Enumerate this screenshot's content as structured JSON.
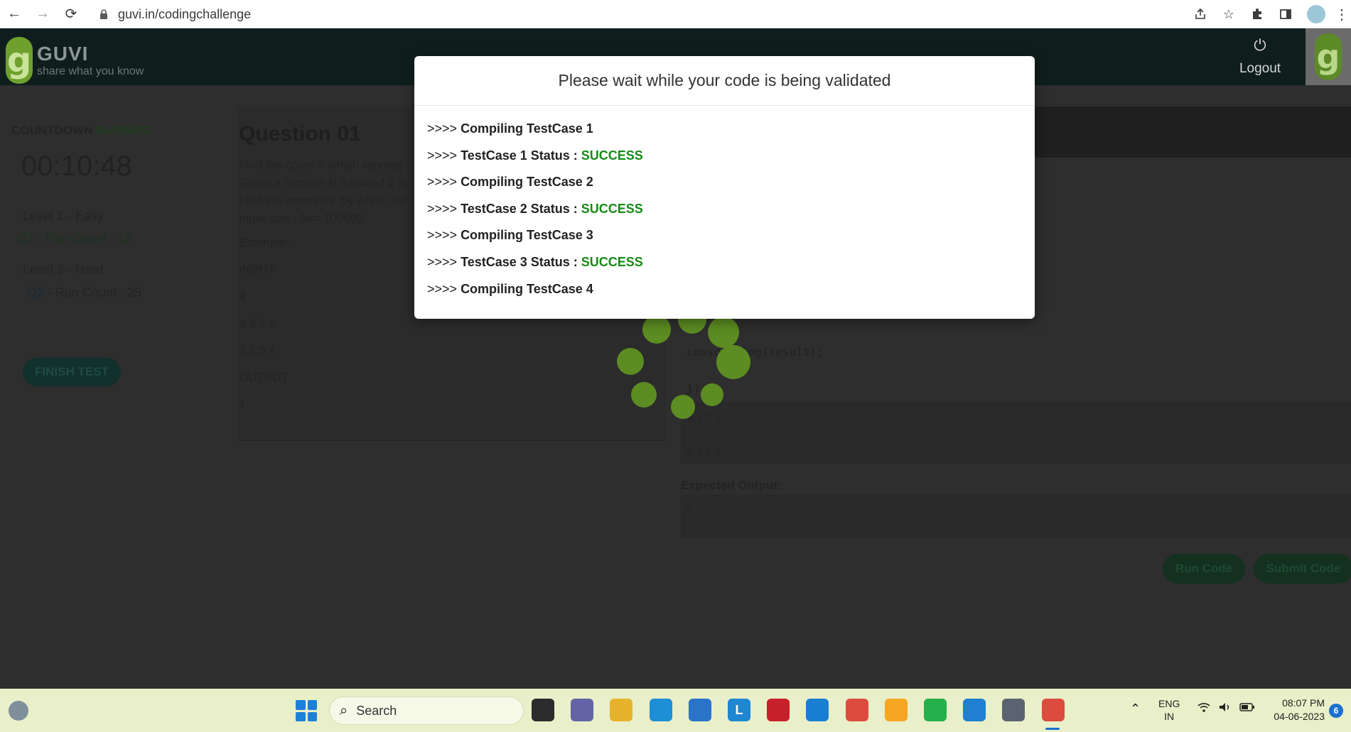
{
  "browser": {
    "url": "guvi.in/codingchallenge",
    "nav": {
      "back": "←",
      "forward": "→",
      "reload": "⟳"
    }
  },
  "header": {
    "logo_title": "GUVI",
    "logo_subtitle": "share what you know",
    "logo_mark": "g",
    "logout_icon": "⏻",
    "logout_label": "Logout"
  },
  "sidebar": {
    "countdown_label": "COUNTDOWN",
    "countdown_state": "RUNNING",
    "timer": "00:10:48",
    "level1": "Level 1 - Easy",
    "q1": "Q1 - Run Count : 12",
    "level3": "Level 3 - Hard",
    "q2_num": "Q2",
    "q2_rest": " - Run Count : 25",
    "finish_button": "FINISH TEST"
  },
  "question": {
    "title": "Question 01",
    "lines": [
      "Find the count k which represe",
      "Given a number N followed 2 ar",
      "Find the amount K by which the",
      "Input size : N<=100000"
    ],
    "example_label": "Example :",
    "input_label": "INPUT",
    "input_lines": [
      "4",
      "4 3 2 5",
      "3 2 5 4"
    ],
    "output_label": "OUTPUT",
    "output_value": "1"
  },
  "editor": {
    "code_line": "console.log(result);",
    "code_line2": "});",
    "sample_input_lines": [
      "4 3 2 5",
      "3 2 5 4"
    ],
    "expected_label": "Expected Output:",
    "expected_value": "1",
    "run_button": "Run Code",
    "submit_button": "Submit Code"
  },
  "modal": {
    "title": "Please wait while your code is being validated",
    "log": [
      {
        "prefix": ">>>> ",
        "msg": "Compiling TestCase 1",
        "status": ""
      },
      {
        "prefix": ">>>> ",
        "msg": "TestCase 1 Status : ",
        "status": "SUCCESS"
      },
      {
        "prefix": ">>>> ",
        "msg": "Compiling TestCase 2",
        "status": ""
      },
      {
        "prefix": ">>>> ",
        "msg": "TestCase 2 Status : ",
        "status": "SUCCESS"
      },
      {
        "prefix": ">>>> ",
        "msg": "Compiling TestCase 3",
        "status": ""
      },
      {
        "prefix": ">>>> ",
        "msg": "TestCase 3 Status : ",
        "status": "SUCCESS"
      },
      {
        "prefix": ">>>> ",
        "msg": "Compiling TestCase 4",
        "status": ""
      }
    ],
    "success_color": "#158a15"
  },
  "taskbar": {
    "search_label": "Search",
    "lang_top": "ENG",
    "lang_bottom": "IN",
    "time": "08:07 PM",
    "date": "04-06-2023",
    "notification_count": "6",
    "apps": [
      {
        "name": "task-view-icon",
        "label": "",
        "color": "#2b2b2b"
      },
      {
        "name": "teams-chat-icon",
        "label": "",
        "color": "#6264a7"
      },
      {
        "name": "file-explorer-icon",
        "label": "",
        "color": "#e8b32c"
      },
      {
        "name": "edge-icon",
        "label": "",
        "color": "#1d8fd6"
      },
      {
        "name": "microsoft-store-icon",
        "label": "",
        "color": "#2a73c8"
      },
      {
        "name": "l-app-icon",
        "label": "L",
        "color": "#1f86d1"
      },
      {
        "name": "mcafee-icon",
        "label": "",
        "color": "#c8202a"
      },
      {
        "name": "circle-app-icon",
        "label": "",
        "color": "#1a7fd3"
      },
      {
        "name": "chrome-icon",
        "label": "",
        "color": "#dd4b3e"
      },
      {
        "name": "sublime-text-icon",
        "label": "",
        "color": "#f5a623"
      },
      {
        "name": "whatsapp-icon",
        "label": "",
        "color": "#25b04b"
      },
      {
        "name": "vscode-icon",
        "label": "",
        "color": "#1f7fd0"
      },
      {
        "name": "settings-icon",
        "label": "",
        "color": "#5a6470"
      },
      {
        "name": "chrome-active-icon",
        "label": "",
        "color": "#dd4b3e"
      }
    ]
  }
}
